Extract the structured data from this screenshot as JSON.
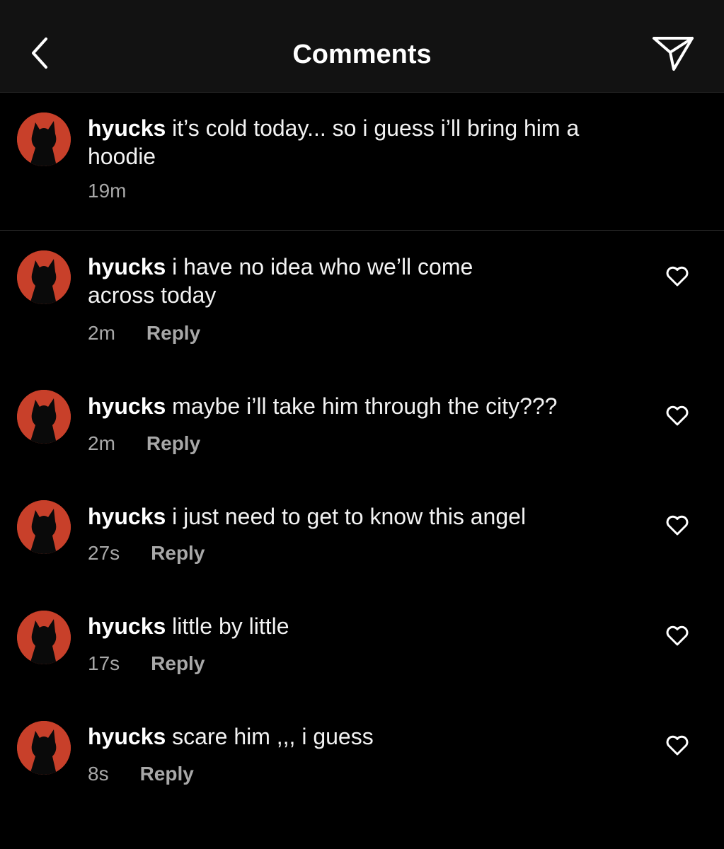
{
  "header": {
    "title": "Comments",
    "back_icon": "chevron-left-icon",
    "share_icon": "paper-plane-icon"
  },
  "caption": {
    "username": "hyucks",
    "text": "it’s cold today... so i guess i’ll bring him a hoodie",
    "time": "19m"
  },
  "comments": [
    {
      "username": "hyucks",
      "text": "i have no idea who we’ll come across today",
      "time": "2m",
      "reply_label": "Reply"
    },
    {
      "username": "hyucks",
      "text": "maybe i’ll take him through the city???",
      "time": "2m",
      "reply_label": "Reply"
    },
    {
      "username": "hyucks",
      "text": "i just need to get to know this angel",
      "time": "27s",
      "reply_label": "Reply"
    },
    {
      "username": "hyucks",
      "text": "little by little",
      "time": "17s",
      "reply_label": "Reply"
    },
    {
      "username": "hyucks",
      "text": "scare him ,,, i guess",
      "time": "8s",
      "reply_label": "Reply"
    }
  ],
  "colors": {
    "background": "#000000",
    "header_background": "#121212",
    "avatar": "#c8402a",
    "secondary_text": "#a8a8a8"
  }
}
